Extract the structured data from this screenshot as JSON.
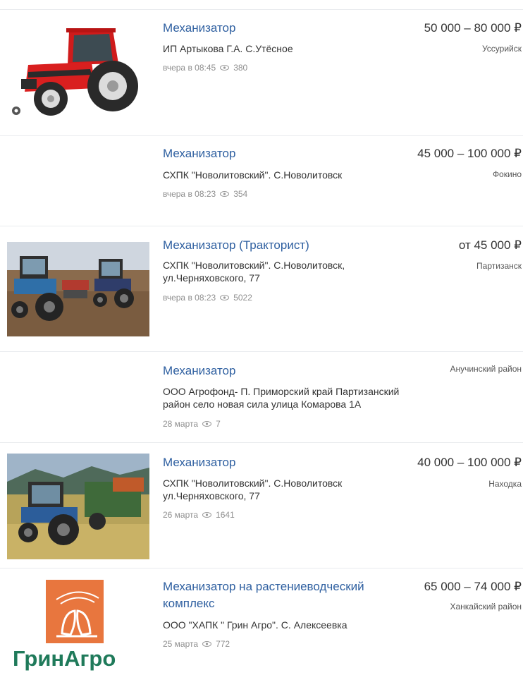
{
  "listings": [
    {
      "title": "Механизатор",
      "company": "ИП Артыкова Г.А. С.Утёсное",
      "date": "вчера в 08:45",
      "views": "380",
      "salary": "50 000 – 80 000 ₽",
      "city": "Уссурийск"
    },
    {
      "title": "Механизатор",
      "company": "СХПК \"Новолитовский\". С.Новолитовск",
      "date": "вчера в 08:23",
      "views": "354",
      "salary": "45 000 – 100 000 ₽",
      "city": "Фокино"
    },
    {
      "title": "Механизатор (Тракторист)",
      "company_line1": "СХПК \"Новолитовский\". С.Новолитовск,",
      "company_line2": "ул.Черняховского, 77",
      "date": "вчера в 08:23",
      "views": "5022",
      "salary": "от 45 000 ₽",
      "city": "Партизанск"
    },
    {
      "title": "Механизатор",
      "company_line1": "ООО Агрофонд- П. Приморский край Партизанский",
      "company_line2": "район село новая сила улица Комарова 1А",
      "date": "28 марта",
      "views": "7",
      "city": "Анучинский район"
    },
    {
      "title": "Механизатор",
      "company_line1": "СХПК \"Новолитовский\". С.Новолитовск",
      "company_line2": "ул.Черняховского, 77",
      "date": "26 марта",
      "views": "1641",
      "salary": "40 000 – 100 000 ₽",
      "city": "Находка"
    },
    {
      "title_line1": "Механизатор на растениеводческий",
      "title_line2": "комплекс",
      "company": "ООО \"ХАПК \" Грин Агро\". С. Алексеевка",
      "date": "25 марта",
      "views": "772",
      "salary": "65 000 – 74 000 ₽",
      "city": "Ханкайский район",
      "logo_text": "ГринАгро"
    }
  ],
  "colors": {
    "link": "#2e5fa0",
    "separator": "#e9ebee",
    "meta": "#8f8f8f",
    "logo_orange": "#e8763e",
    "logo_green": "#1f7a5a"
  }
}
